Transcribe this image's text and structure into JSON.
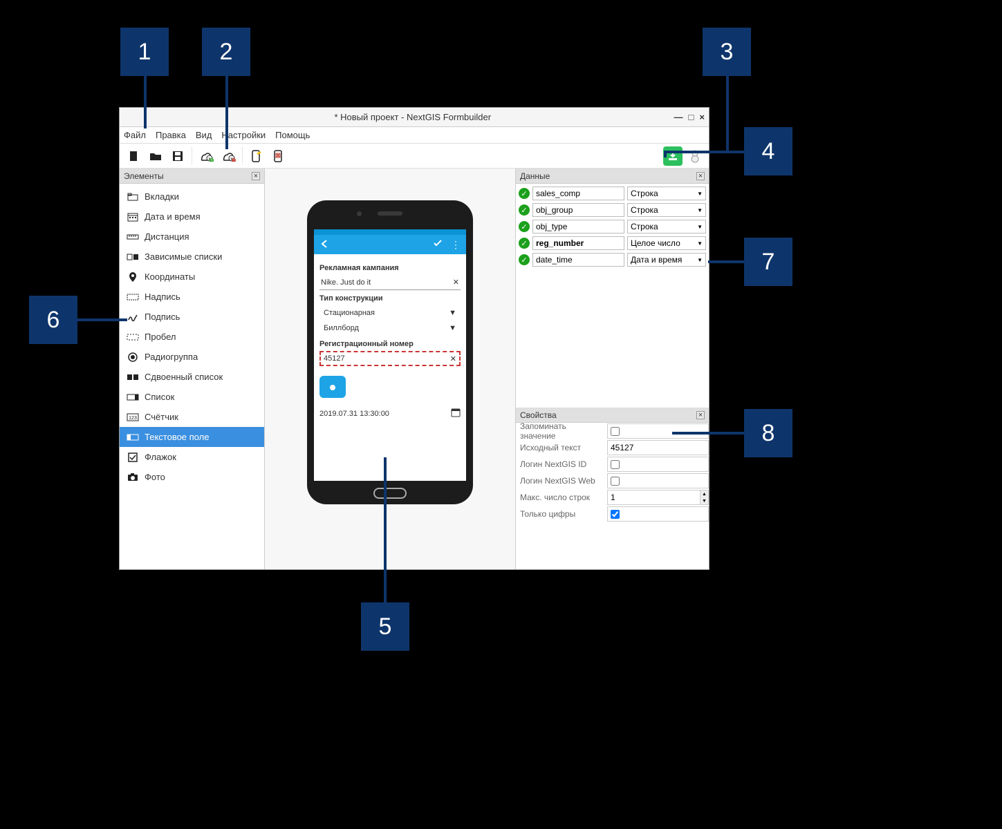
{
  "callouts": [
    "1",
    "2",
    "3",
    "4",
    "5",
    "6",
    "7",
    "8"
  ],
  "window": {
    "title": "* Новый проект - NextGIS Formbuilder",
    "controls": {
      "min": "—",
      "max": "□",
      "close": "×"
    }
  },
  "menu": [
    "Файл",
    "Правка",
    "Вид",
    "Настройки",
    "Помощь"
  ],
  "panels": {
    "elements_title": "Элементы",
    "data_title": "Данные",
    "props_title": "Свойства"
  },
  "elements": [
    {
      "label": "Вкладки",
      "icon": "tabs-icon",
      "sel": false
    },
    {
      "label": "Дата и время",
      "icon": "calendar-icon",
      "sel": false
    },
    {
      "label": "Дистанция",
      "icon": "ruler-icon",
      "sel": false
    },
    {
      "label": "Зависимые списки",
      "icon": "deplist-icon",
      "sel": false
    },
    {
      "label": "Координаты",
      "icon": "pin-icon",
      "sel": false
    },
    {
      "label": "Надпись",
      "icon": "label-icon",
      "sel": false
    },
    {
      "label": "Подпись",
      "icon": "signature-icon",
      "sel": false
    },
    {
      "label": "Пробел",
      "icon": "space-icon",
      "sel": false
    },
    {
      "label": "Радиогруппа",
      "icon": "radio-icon",
      "sel": false
    },
    {
      "label": "Сдвоенный список",
      "icon": "duallist-icon",
      "sel": false
    },
    {
      "label": "Список",
      "icon": "list-icon",
      "sel": false
    },
    {
      "label": "Счётчик",
      "icon": "counter-icon",
      "sel": false
    },
    {
      "label": "Текстовое поле",
      "icon": "textfield-icon",
      "sel": true
    },
    {
      "label": "Флажок",
      "icon": "checkbox-icon",
      "sel": false
    },
    {
      "label": "Фото",
      "icon": "photo-icon",
      "sel": false
    }
  ],
  "data_fields": [
    {
      "name": "sales_comp",
      "type": "Строка",
      "bold": false
    },
    {
      "name": "obj_group",
      "type": "Строка",
      "bold": false
    },
    {
      "name": "obj_type",
      "type": "Строка",
      "bold": false
    },
    {
      "name": "reg_number",
      "type": "Целое число",
      "bold": true
    },
    {
      "name": "date_time",
      "type": "Дата и время",
      "bold": false
    }
  ],
  "properties": {
    "remember": {
      "label": "Запоминать значение",
      "checked": false
    },
    "initial": {
      "label": "Исходный текст",
      "value": "45127"
    },
    "login_id": {
      "label": "Логин NextGIS ID",
      "checked": false
    },
    "login_web": {
      "label": "Логин NextGIS Web",
      "checked": false
    },
    "maxlines": {
      "label": "Макс. число строк",
      "value": "1"
    },
    "digits": {
      "label": "Только цифры",
      "checked": true
    }
  },
  "phone": {
    "campaign_label": "Рекламная кампания",
    "campaign_value": "Nike. Just do it",
    "type_label": "Тип конструкции",
    "type_value1": "Стационарная",
    "type_value2": "Биллборд",
    "reg_label": "Регистрационный номер",
    "reg_value": "45127",
    "date_value": "2019.07.31 13:30:00"
  }
}
